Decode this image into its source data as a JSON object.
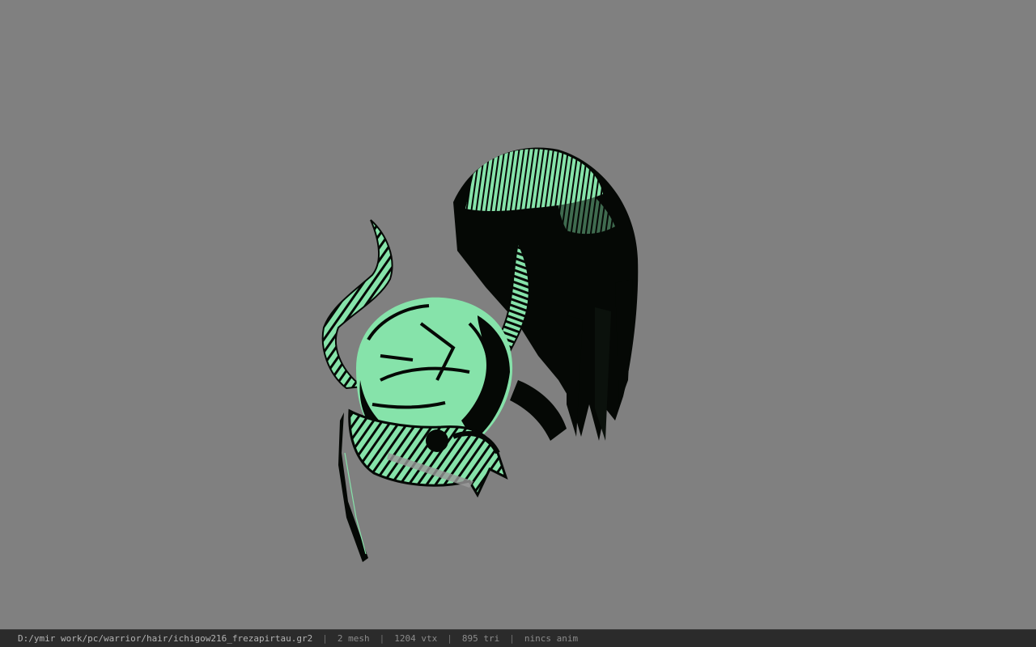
{
  "statusbar": {
    "file_path": "D:/ymir work/pc/warrior/hair/ichigow216_frezapirtau.gr2",
    "separator": "|",
    "mesh_count": "2 mesh",
    "vertex_count": "1204 vtx",
    "triangle_count": "895 tri",
    "animation": "nincs anim"
  },
  "viewport": {
    "background_color": "#808080",
    "model_colors": {
      "light": "#86e3aa",
      "dark": "#050805"
    }
  }
}
